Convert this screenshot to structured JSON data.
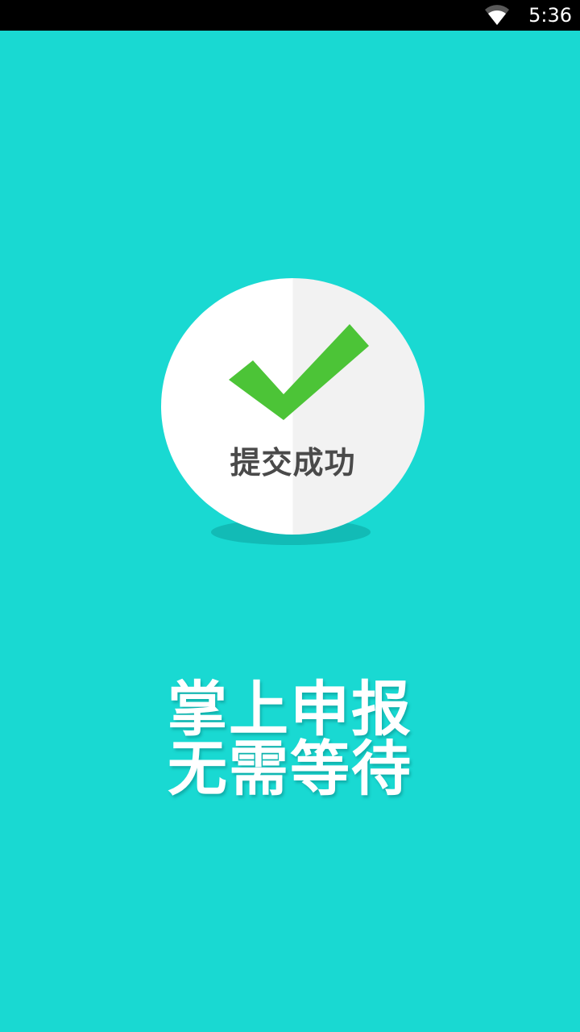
{
  "status_bar": {
    "time": "5:36",
    "wifi_icon": "wifi-icon"
  },
  "badge": {
    "label": "提交成功",
    "check_icon": "checkmark-icon",
    "check_color": "#4CC437"
  },
  "slogan": {
    "line1": "掌上申报",
    "line2": "无需等待"
  },
  "colors": {
    "background": "#19D9D2",
    "status_bar": "#000000"
  }
}
